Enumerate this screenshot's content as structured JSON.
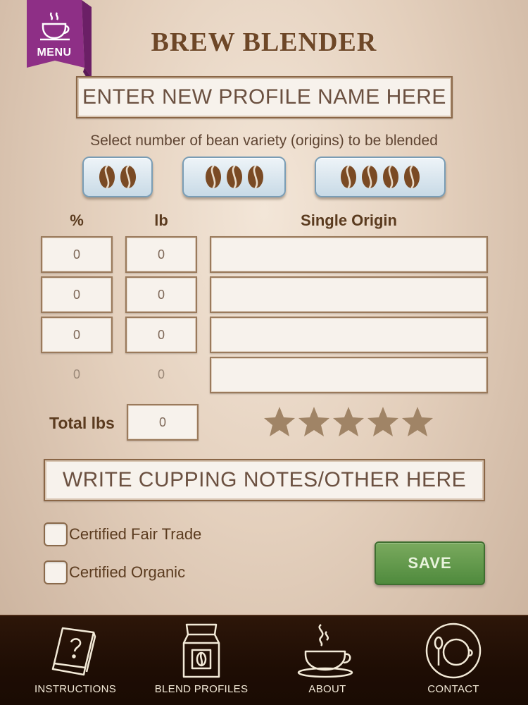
{
  "menu": {
    "label": "MENU",
    "icon": "coffee-cup-icon"
  },
  "app_title": "BREW BLENDER",
  "profile_name": {
    "placeholder": "ENTER NEW PROFILE NAME HERE"
  },
  "bean_selector": {
    "prompt": "Select number of bean variety (origins) to be blended",
    "options": [
      {
        "count": 2,
        "icon": "coffee-bean-icon"
      },
      {
        "count": 3,
        "icon": "coffee-bean-icon"
      },
      {
        "count": 4,
        "icon": "coffee-bean-icon"
      }
    ]
  },
  "blend_table": {
    "headers": {
      "percent": "%",
      "lb": "lb",
      "origin": "Single Origin"
    },
    "rows": [
      {
        "percent": "0",
        "lb": "0",
        "origin": ""
      },
      {
        "percent": "0",
        "lb": "0",
        "origin": ""
      },
      {
        "percent": "0",
        "lb": "0",
        "origin": ""
      },
      {
        "percent": "0",
        "lb": "0",
        "origin": ""
      }
    ]
  },
  "total": {
    "label": "Total lbs",
    "value": "0"
  },
  "rating": {
    "stars_total": 5,
    "stars_filled": 0,
    "icon": "star-icon"
  },
  "notes": {
    "placeholder": "WRITE CUPPING NOTES/OTHER HERE"
  },
  "certifications": [
    {
      "label": "Certified Fair Trade",
      "checked": false
    },
    {
      "label": "Certified Organic",
      "checked": false
    }
  ],
  "save_label": "SAVE",
  "colors": {
    "accent_menu": "#8e2f86",
    "save_green": "#5a9446",
    "title_brown": "#6e4727",
    "bean_button_blue": "#c8dae6",
    "tab_bar": "#1e0d04"
  },
  "tab_bar": {
    "tabs": [
      {
        "label": "INSTRUCTIONS",
        "icon": "book-question-icon"
      },
      {
        "label": "BLEND PROFILES",
        "icon": "coffee-bag-icon"
      },
      {
        "label": "ABOUT",
        "icon": "steaming-cup-icon"
      },
      {
        "label": "CONTACT",
        "icon": "plate-spoon-cup-icon"
      }
    ]
  }
}
